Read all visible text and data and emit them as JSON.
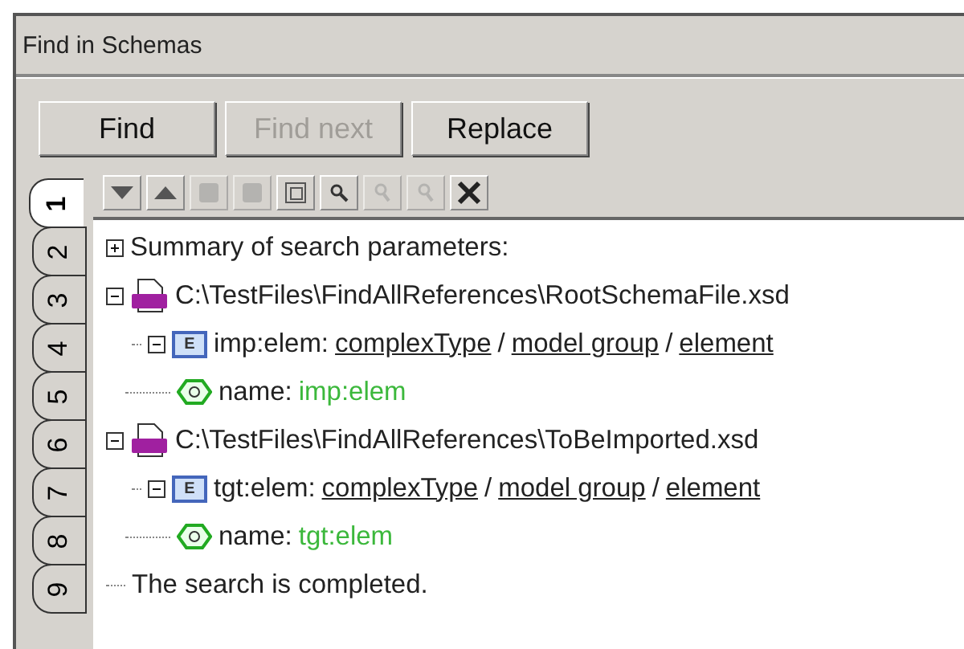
{
  "window": {
    "title": "Find in Schemas"
  },
  "buttons": [
    {
      "label": "Find",
      "disabled": false
    },
    {
      "label": "Find next",
      "disabled": true
    },
    {
      "label": "Replace",
      "disabled": false
    }
  ],
  "toolbar": [
    {
      "disabled": false
    },
    {
      "disabled": false
    },
    {
      "disabled": true
    },
    {
      "disabled": true
    },
    {
      "disabled": false
    },
    {
      "disabled": false
    },
    {
      "disabled": true
    },
    {
      "disabled": true
    },
    {
      "disabled": false
    }
  ],
  "tabs": [
    {
      "label": "1",
      "selected": true
    },
    {
      "label": "2",
      "selected": false
    },
    {
      "label": "3",
      "selected": false
    },
    {
      "label": "4",
      "selected": false
    },
    {
      "label": "5",
      "selected": false
    },
    {
      "label": "6",
      "selected": false
    },
    {
      "label": "7",
      "selected": false
    },
    {
      "label": "8",
      "selected": false
    },
    {
      "label": "9",
      "selected": false
    }
  ],
  "tree": [
    {
      "kind": "summary",
      "label": "Summary of search parameters:",
      "expanded": false
    },
    {
      "kind": "file",
      "label": "C:\\TestFiles\\FindAllReferences\\RootSchemaFile.xsd",
      "expanded": true,
      "children": [
        {
          "kind": "element",
          "badge": "E",
          "label": "imp:elem:",
          "links": [
            "complexType",
            "model group",
            "element"
          ],
          "separator": "/",
          "expanded": true,
          "children": [
            {
              "kind": "attribute",
              "label": "name:",
              "value": "imp:elem"
            }
          ]
        }
      ]
    },
    {
      "kind": "file",
      "label": "C:\\TestFiles\\FindAllReferences\\ToBeImported.xsd",
      "expanded": true,
      "children": [
        {
          "kind": "element",
          "badge": "E",
          "label": "tgt:elem:",
          "links": [
            "complexType",
            "model group",
            "element"
          ],
          "separator": "/",
          "expanded": true,
          "children": [
            {
              "kind": "attribute",
              "label": "name:",
              "value": "tgt:elem"
            }
          ]
        }
      ]
    },
    {
      "kind": "message",
      "label": "The search is completed."
    }
  ]
}
